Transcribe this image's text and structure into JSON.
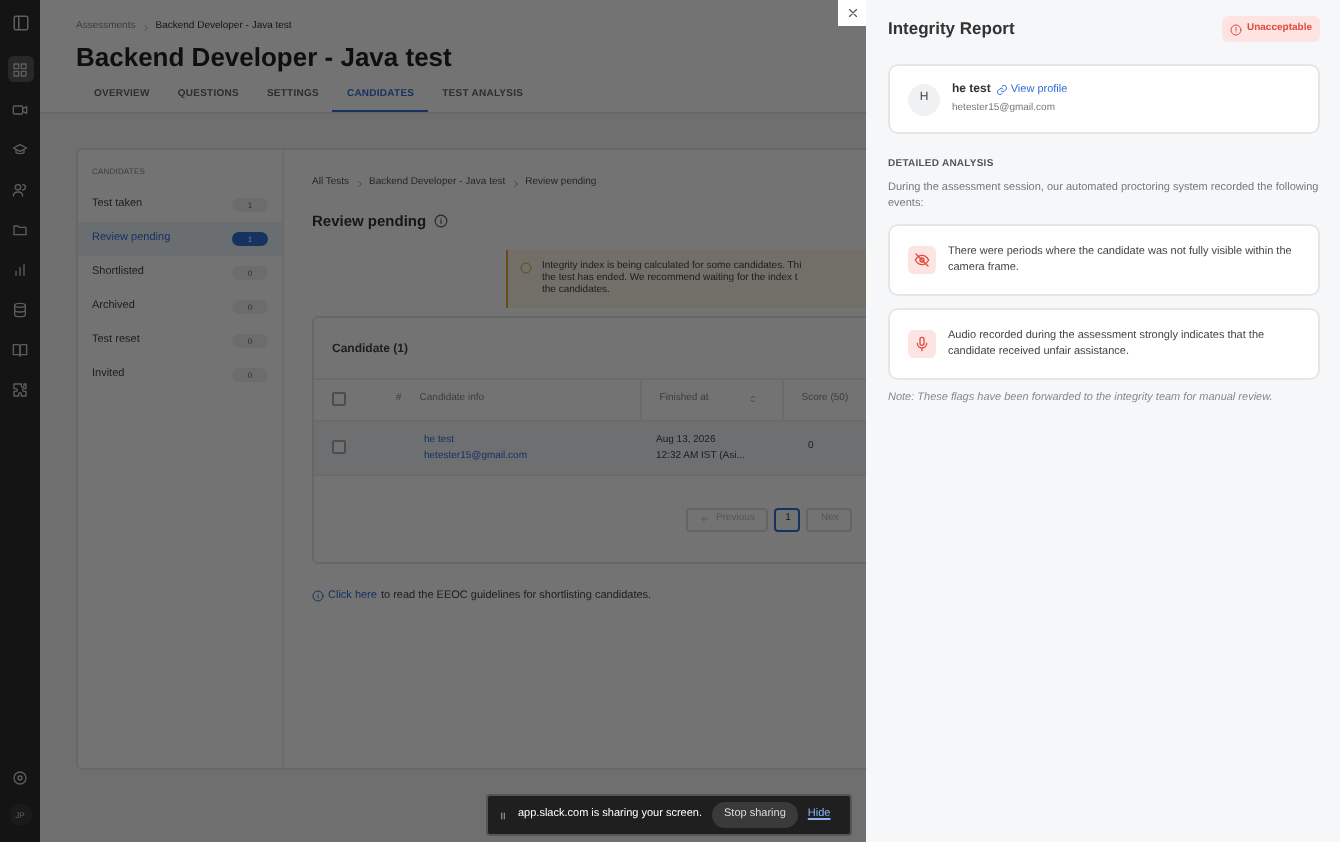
{
  "rail": {
    "items": [
      {
        "selected": true
      },
      {
        "selected": false
      },
      {
        "selected": false
      },
      {
        "selected": false
      },
      {
        "selected": false
      },
      {
        "selected": false
      },
      {
        "selected": false
      },
      {
        "selected": false
      },
      {
        "selected": false
      }
    ],
    "avatar": "JP"
  },
  "breadcrumb": [
    "Assessments",
    "Backend Developer - Java test"
  ],
  "title": "Backend Developer - Java test",
  "tabs": [
    {
      "label": "OVERVIEW",
      "selected": false
    },
    {
      "label": "QUESTIONS",
      "selected": false
    },
    {
      "label": "SETTINGS",
      "selected": false
    },
    {
      "label": "CANDIDATES",
      "selected": true
    },
    {
      "label": "TEST ANALYSIS",
      "selected": false
    }
  ],
  "candidates_panel": {
    "heading": "CANDIDATES",
    "items": [
      {
        "label": "Test taken",
        "count": "1",
        "selected": false
      },
      {
        "label": "Review pending",
        "count": "1",
        "selected": true
      },
      {
        "label": "Shortlisted",
        "count": "0",
        "selected": false
      },
      {
        "label": "Archived",
        "count": "0",
        "selected": false
      },
      {
        "label": "Test reset",
        "count": "0",
        "selected": false
      },
      {
        "label": "Invited",
        "count": "0",
        "selected": false
      }
    ]
  },
  "content": {
    "breadcrumb": [
      "All Tests",
      "Backend Developer - Java test",
      "Review pending"
    ],
    "heading": "Review pending",
    "alert_lines": [
      "Integrity index is being calculated for some candidates. Thi",
      "the test has ended. We recommend waiting for the index t",
      "the candidates."
    ],
    "table_title": "Candidate (1)",
    "select_all_checked": false,
    "columns": [
      "#",
      "Candidate info",
      "Finished at",
      "Score (50)"
    ],
    "rows": [
      {
        "checked": false,
        "name": "he test",
        "email": "hetester15@gmail.com",
        "finished_date": "Aug 13, 2026",
        "finished_time": "12:32 AM IST (Asi...",
        "score": "0"
      }
    ],
    "pagination": {
      "previous": "Previous",
      "page": "1",
      "next": "Nex"
    },
    "guideline_link": "Click here",
    "guideline_text": "to read the EEOC guidelines for shortlisting candidates."
  },
  "share_bar": {
    "message": "app.slack.com is sharing your screen.",
    "stop": "Stop sharing",
    "hide": "Hide"
  },
  "drawer": {
    "title": "Integrity Report",
    "status": "Unacceptable",
    "profile": {
      "initial": "H",
      "name": "he test",
      "link": "View profile",
      "email": "hetester15@gmail.com"
    },
    "section": "DETAILED ANALYSIS",
    "intro": "During the assessment session, our automated proctoring system recorded the following events:",
    "events": [
      {
        "kind": "camera",
        "text": "There were periods where the candidate was not fully visible within the camera frame."
      },
      {
        "kind": "audio",
        "text": "Audio recorded during the assessment strongly indicates that the candidate received unfair assistance."
      }
    ],
    "note": "Note: These flags have been forwarded to the integrity team for manual review."
  }
}
